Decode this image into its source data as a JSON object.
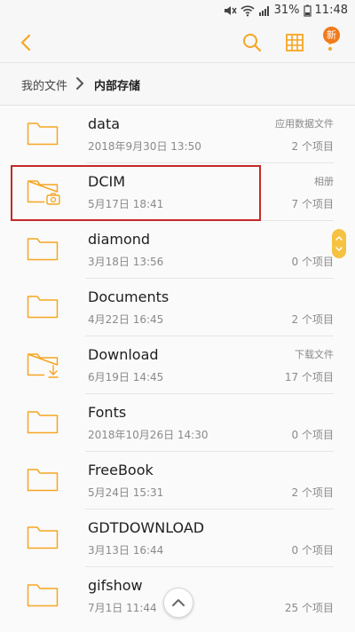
{
  "status": {
    "battery_percent": "31%",
    "time": "11:48"
  },
  "toolbar": {
    "badge": "新"
  },
  "breadcrumb": {
    "root": "我的文件",
    "current": "内部存储"
  },
  "files": [
    {
      "name": "data",
      "date": "2018年9月30日 13:50",
      "type": "应用数据文件",
      "count": "2 个项目",
      "icon": "folder-icon"
    },
    {
      "name": "DCIM",
      "date": "5月17日 18:41",
      "type": "相册",
      "count": "7 个项目",
      "icon": "camera-folder-icon"
    },
    {
      "name": "diamond",
      "date": "3月18日 13:56",
      "type": "",
      "count": "0 个项目",
      "icon": "folder-icon"
    },
    {
      "name": "Documents",
      "date": "4月22日 16:45",
      "type": "",
      "count": "2 个项目",
      "icon": "folder-icon"
    },
    {
      "name": "Download",
      "date": "6月19日 14:45",
      "type": "下载文件",
      "count": "17 个项目",
      "icon": "download-folder-icon"
    },
    {
      "name": "Fonts",
      "date": "2018年10月26日 14:30",
      "type": "",
      "count": "0 个项目",
      "icon": "folder-icon"
    },
    {
      "name": "FreeBook",
      "date": "5月24日 15:31",
      "type": "",
      "count": "2 个项目",
      "icon": "folder-icon"
    },
    {
      "name": "GDTDOWNLOAD",
      "date": "3月13日 16:44",
      "type": "",
      "count": "0 个项目",
      "icon": "folder-icon"
    },
    {
      "name": "gifshow",
      "date": "7月1日 11:44",
      "type": "",
      "count": "25 个项目",
      "icon": "folder-icon"
    }
  ],
  "colors": {
    "accent": "#f5a623",
    "highlight": "#c62828"
  }
}
